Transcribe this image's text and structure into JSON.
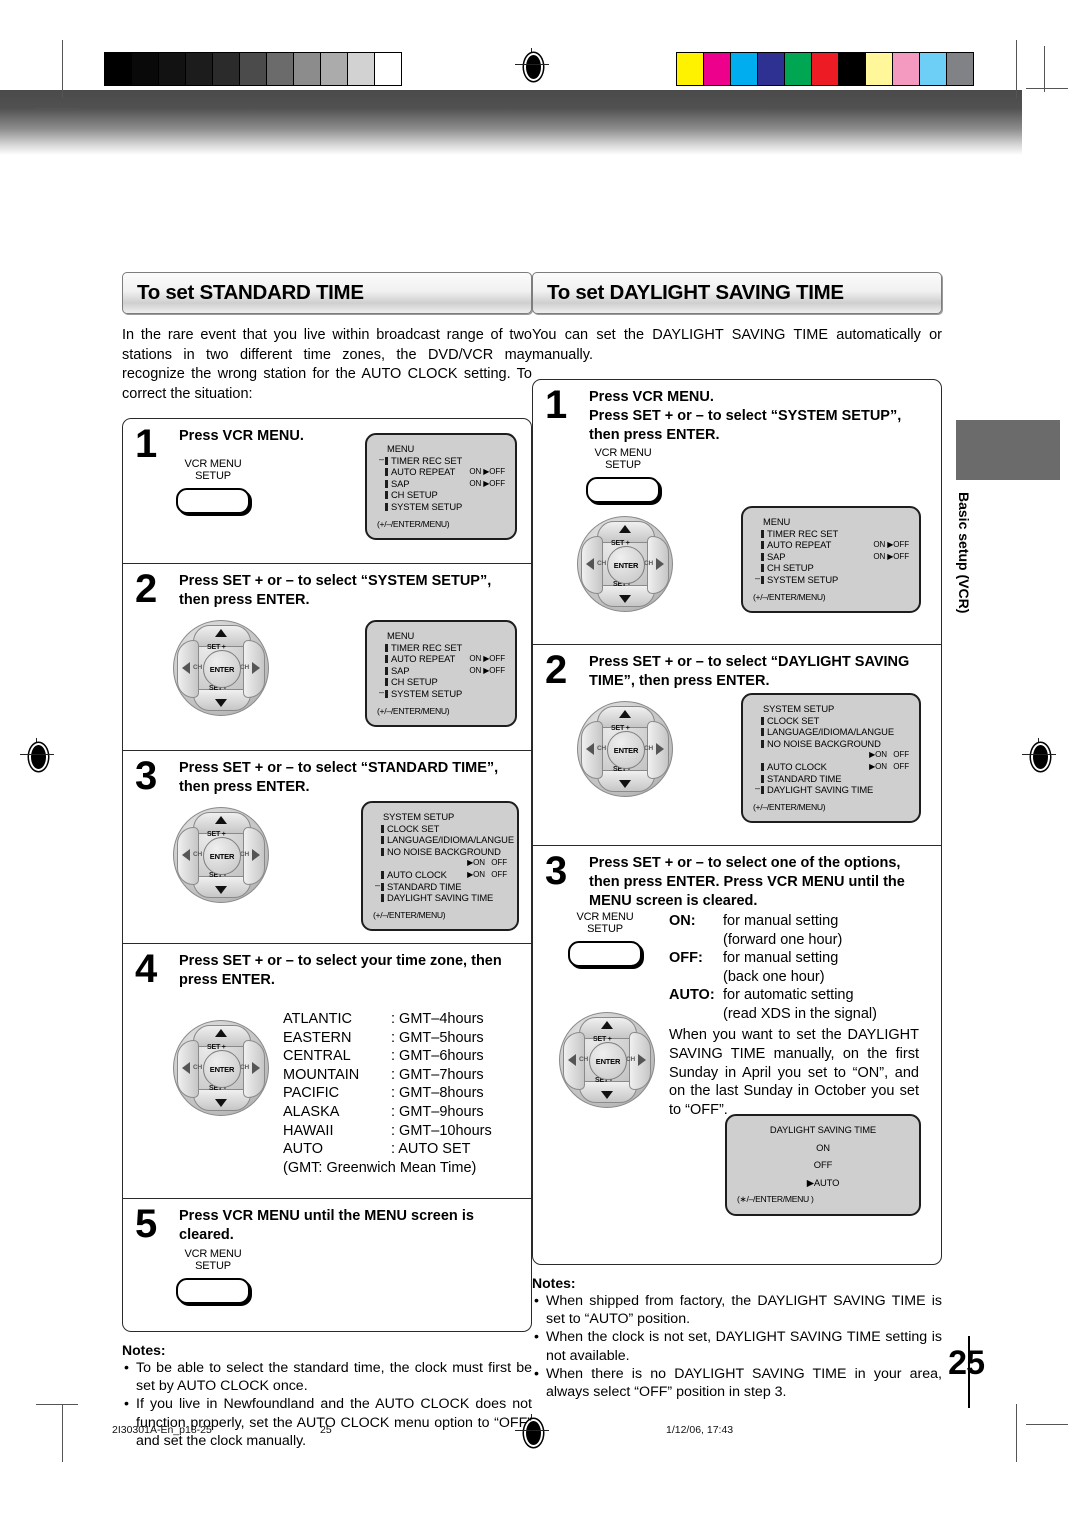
{
  "scan": {
    "grayscale_patches": [
      "#000000",
      "#090909",
      "#121212",
      "#1c1c1c",
      "#2b2b2b",
      "#4b4b4b",
      "#6b6b6b",
      "#8c8c8c",
      "#ababab",
      "#d2d2d2",
      "#ffffff"
    ],
    "color_patches": [
      "#fff200",
      "#ec008c",
      "#00aeef",
      "#2e3192",
      "#00a651",
      "#ed1c24",
      "#000000",
      "#fff79a",
      "#f49ac1",
      "#6dcff6",
      "#808285"
    ]
  },
  "left": {
    "title": "To set STANDARD TIME",
    "intro": "In the rare event that you live within broadcast range of two stations in two different time zones, the DVD/VCR may recognize the wrong station for the AUTO CLOCK setting. To correct the situation:",
    "steps": [
      {
        "num": "1",
        "head": "Press VCR MENU.",
        "button": {
          "line1": "VCR MENU",
          "line2": "SETUP"
        },
        "osd": {
          "title": "MENU",
          "hint": "(+/–/ENTER/MENU)",
          "rows": [
            {
              "name": "TIMER REC SET",
              "value": ""
            },
            {
              "name": "AUTO REPEAT",
              "value": "ON ▶OFF"
            },
            {
              "name": "SAP",
              "value": "ON ▶OFF"
            },
            {
              "name": "CH SETUP",
              "value": ""
            },
            {
              "name": "SYSTEM SETUP",
              "value": ""
            }
          ],
          "cursor_row": 0
        }
      },
      {
        "num": "2",
        "head": "Press SET + or – to select “SYSTEM SETUP”, then press ENTER.",
        "osd": {
          "title": "MENU",
          "hint": "(+/–/ENTER/MENU)",
          "rows": [
            {
              "name": "TIMER REC SET",
              "value": ""
            },
            {
              "name": "AUTO REPEAT",
              "value": "ON ▶OFF"
            },
            {
              "name": "SAP",
              "value": "ON ▶OFF"
            },
            {
              "name": "CH SETUP",
              "value": ""
            },
            {
              "name": "SYSTEM SETUP",
              "value": ""
            }
          ],
          "cursor_row": 4
        }
      },
      {
        "num": "3",
        "head": "Press SET + or – to select “STANDARD TIME”, then press ENTER.",
        "osd": {
          "title": "SYSTEM SETUP",
          "hint": "(+/–/ENTER/MENU)",
          "rows": [
            {
              "name": "CLOCK SET",
              "value": ""
            },
            {
              "name": "LANGUAGE/IDIOMA/LANGUE",
              "value": ""
            },
            {
              "name": "NO NOISE BACKGROUND",
              "value": ""
            },
            {
              "name": "",
              "value": "▶ON   OFF"
            },
            {
              "name": "AUTO CLOCK",
              "value": "▶ON   OFF"
            },
            {
              "name": "STANDARD TIME",
              "value": ""
            },
            {
              "name": "DAYLIGHT SAVING TIME",
              "value": ""
            }
          ],
          "cursor_row": 5
        }
      },
      {
        "num": "4",
        "head": "Press SET + or – to select your time zone, then press ENTER.",
        "timezones": [
          {
            "zone": "ATLANTIC",
            "gmt": ": GMT–4hours"
          },
          {
            "zone": "EASTERN",
            "gmt": ": GMT–5hours"
          },
          {
            "zone": "CENTRAL",
            "gmt": ": GMT–6hours"
          },
          {
            "zone": "MOUNTAIN",
            "gmt": ": GMT–7hours"
          },
          {
            "zone": "PACIFIC",
            "gmt": ": GMT–8hours"
          },
          {
            "zone": "ALASKA",
            "gmt": ": GMT–9hours"
          },
          {
            "zone": "HAWAII",
            "gmt": ": GMT–10hours"
          },
          {
            "zone": "AUTO",
            "gmt": ": AUTO SET"
          }
        ],
        "timezone_note": "(GMT: Greenwich Mean Time)"
      },
      {
        "num": "5",
        "head": "Press VCR MENU until the MENU screen is cleared.",
        "button": {
          "line1": "VCR MENU",
          "line2": "SETUP"
        }
      }
    ],
    "notes": {
      "heading": "Notes:",
      "items": [
        "To be able to select the standard time, the clock must first be set by AUTO CLOCK once.",
        "If you live in Newfoundland and the AUTO CLOCK does not function properly, set the AUTO CLOCK menu option to “OFF” and set the clock manually."
      ]
    }
  },
  "right": {
    "title": "To set DAYLIGHT SAVING TIME",
    "intro": "You can set the DAYLIGHT SAVING TIME automatically or manually.",
    "steps": [
      {
        "num": "1",
        "head": "Press VCR MENU.\nPress SET + or – to select “SYSTEM SETUP”, then press ENTER.",
        "button": {
          "line1": "VCR MENU",
          "line2": "SETUP"
        },
        "osd": {
          "title": "MENU",
          "hint": "(+/–/ENTER/MENU)",
          "rows": [
            {
              "name": "TIMER REC SET",
              "value": ""
            },
            {
              "name": "AUTO REPEAT",
              "value": "ON ▶OFF"
            },
            {
              "name": "SAP",
              "value": "ON ▶OFF"
            },
            {
              "name": "CH SETUP",
              "value": ""
            },
            {
              "name": "SYSTEM SETUP",
              "value": ""
            }
          ],
          "cursor_row": 4
        }
      },
      {
        "num": "2",
        "head": "Press SET + or – to select “DAYLIGHT SAVING TIME”, then press ENTER.",
        "osd": {
          "title": "SYSTEM SETUP",
          "hint": "(+/–/ENTER/MENU)",
          "rows": [
            {
              "name": "CLOCK SET",
              "value": ""
            },
            {
              "name": "LANGUAGE/IDIOMA/LANGUE",
              "value": ""
            },
            {
              "name": "NO NOISE BACKGROUND",
              "value": ""
            },
            {
              "name": "",
              "value": "▶ON   OFF"
            },
            {
              "name": "AUTO CLOCK",
              "value": "▶ON   OFF"
            },
            {
              "name": "STANDARD TIME",
              "value": ""
            },
            {
              "name": "DAYLIGHT SAVING TIME",
              "value": ""
            }
          ],
          "cursor_row": 6
        }
      },
      {
        "num": "3",
        "head": "Press SET + or – to select one of the options, then press ENTER. Press VCR MENU until the MENU screen is cleared.",
        "button": {
          "line1": "VCR MENU",
          "line2": "SETUP"
        },
        "options": [
          {
            "key": "ON:",
            "desc": "for manual setting",
            "sub": "(forward one hour)"
          },
          {
            "key": "OFF:",
            "desc": "for manual setting",
            "sub": "(back one hour)"
          },
          {
            "key": "AUTO:",
            "desc": "for automatic setting",
            "sub": "(read XDS in the signal)"
          }
        ],
        "paragraph": "When you want to set the DAYLIGHT SAVING TIME manually, on the first Sunday in April you set to “ON”, and on the last Sunday in October you set to “OFF”.",
        "osd": {
          "title": "DAYLIGHT  SAVING  TIME",
          "hint": "(∗/–/ENTER/MENU )",
          "options": [
            "ON",
            "OFF",
            "▶AUTO"
          ],
          "selected": "AUTO"
        }
      }
    ],
    "notes": {
      "heading": "Notes:",
      "items": [
        "When shipped from factory, the DAYLIGHT SAVING TIME is set to “AUTO” position.",
        "When the clock is not set, DAYLIGHT SAVING TIME setting is not available.",
        "When there is no DAYLIGHT SAVING TIME in your area, always select “OFF” position in step 3."
      ]
    }
  },
  "side_tab": {
    "label": "Basic setup (VCR)"
  },
  "page_number": "25",
  "footer": {
    "file": "2I30301A-En_p18-25",
    "page": "25",
    "date": "1/12/06, 17:43"
  }
}
